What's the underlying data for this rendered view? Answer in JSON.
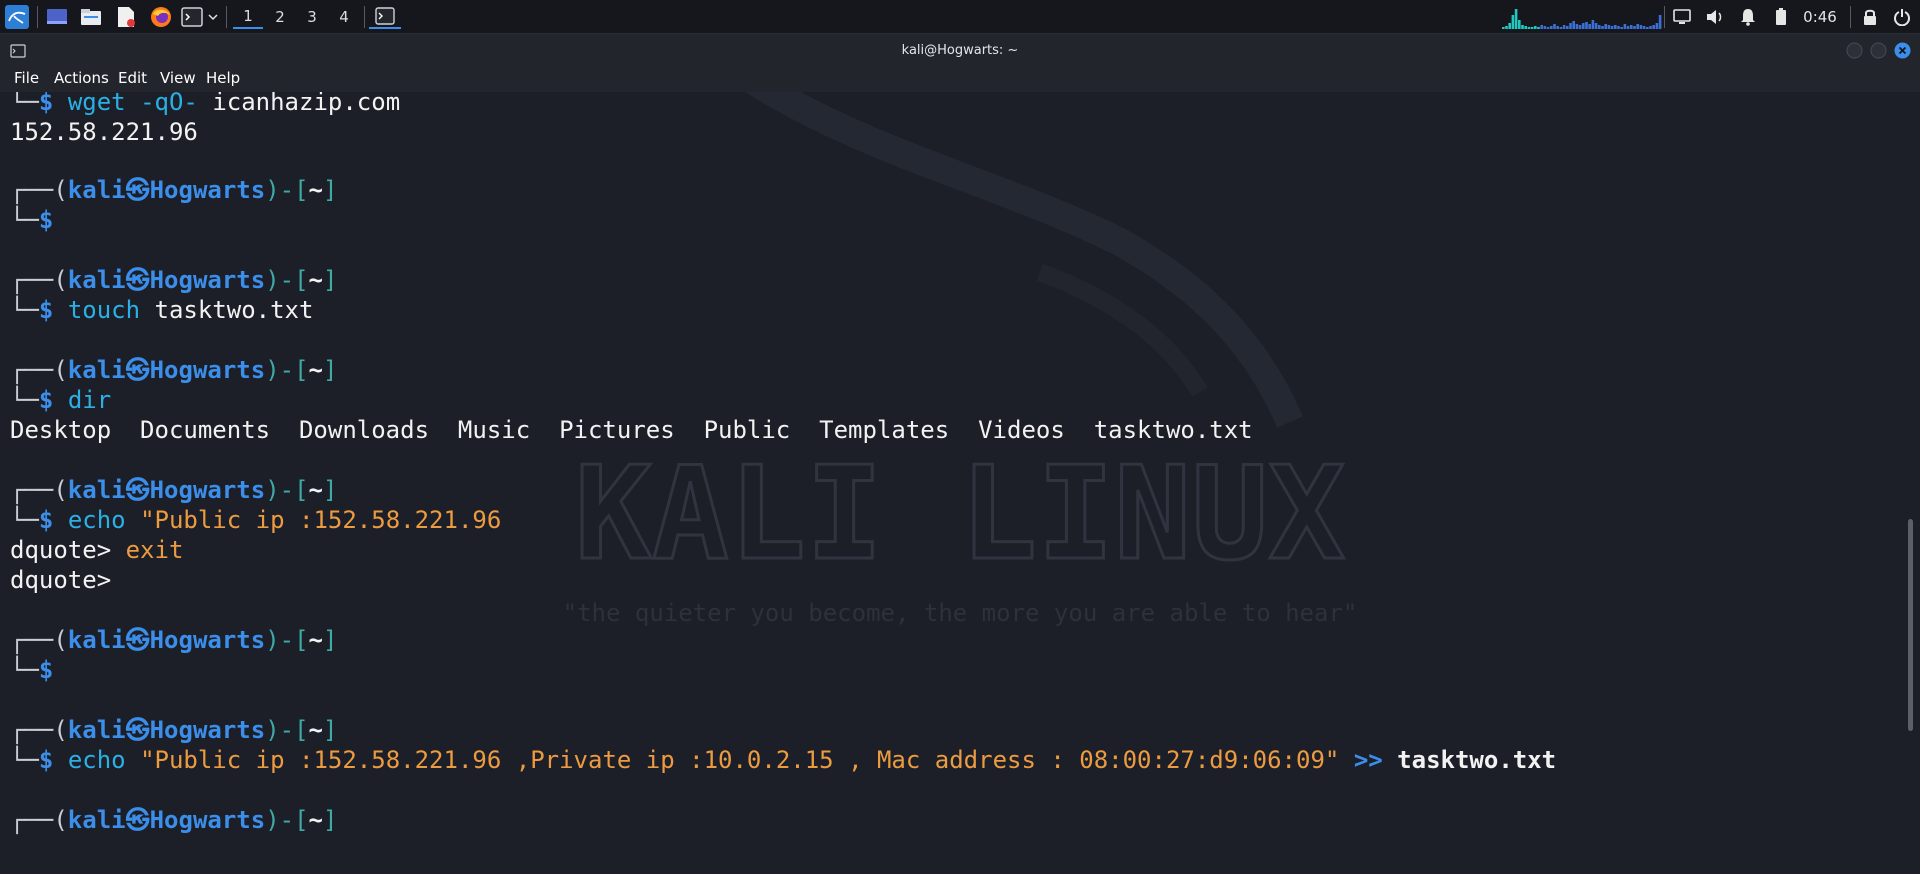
{
  "panel": {
    "workspaces": [
      "1",
      "2",
      "3",
      "4"
    ],
    "active_workspace": "1",
    "clock": "0:46"
  },
  "window": {
    "title": "kali@Hogwarts: ~",
    "menu": [
      "File",
      "Actions",
      "Edit",
      "View",
      "Help"
    ]
  },
  "wallpaper": {
    "logo_text": "KALI LINUX",
    "tagline": "\"the quieter you become, the more you are able to hear\""
  },
  "prompt": {
    "open": "┌──(",
    "user": "kali",
    "at_icon": "㉿",
    "host": "Hogwarts",
    "mid": ")-[",
    "dir": "~",
    "close": "]",
    "bottom": "└─",
    "dollar": "$"
  },
  "terminal": {
    "l01_cmd": "wget",
    "l01_opt": "-qO-",
    "l01_arg": "icanhazip.com",
    "l02_out": "152.58.221.96",
    "l06_cmd": "touch",
    "l06_arg": "tasktwo.txt",
    "l08_cmd": "dir",
    "l09_out": "Desktop  Documents  Downloads  Music  Pictures  Public  Templates  Videos  tasktwo.txt",
    "l11_cmd": "echo",
    "l11_str": "\"Public ip :152.58.221.96",
    "l12_prefix": "dquote>",
    "l12_text": "exit",
    "l13_prefix": "dquote>",
    "l17_cmd": "echo",
    "l17_str": "\"Public ip :152.58.221.96 ,Private ip :10.0.2.15 , Mac address : 08:00:27:d9:06:09\"",
    "l17_redir": ">>",
    "l17_file": "tasktwo.txt"
  },
  "colors": {
    "prompt_blue": "#3b8eea",
    "paren_teal": "#3fa9a5",
    "command_cyan": "#2bb0e6",
    "string_orange": "#ec9b40",
    "background": "#1c1f27"
  }
}
